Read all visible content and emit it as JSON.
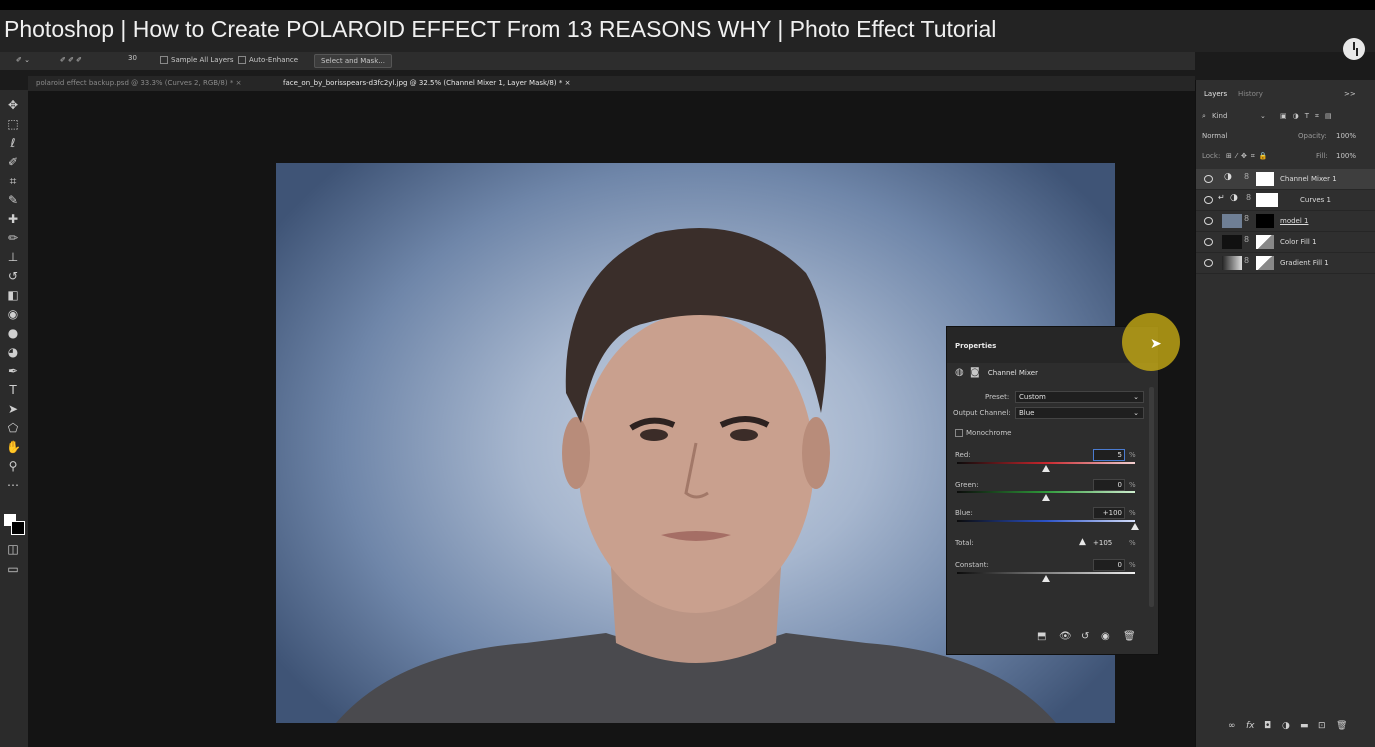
{
  "video_title": "Photoshop | How to Create POLAROID EFFECT From 13 REASONS WHY | Photo Effect Tutorial",
  "options": {
    "brush_size": "30",
    "sample_all_layers": "Sample All Layers",
    "auto_enhance": "Auto-Enhance",
    "select_and_mask": "Select and Mask..."
  },
  "tabs": [
    {
      "label": "polaroid effect backup.psd @ 33.3% (Curves 2, RGB/8) *",
      "close": "×"
    },
    {
      "label": "face_on_by_borisspears-d3fc2yl.jpg @ 32.5% (Channel Mixer 1, Layer Mask/8) *",
      "close": "×"
    }
  ],
  "layers_panel": {
    "tab_layers": "Layers",
    "tab_history": "History",
    "collapse": ">>",
    "kind": "Kind",
    "blend_mode": "Normal",
    "opacity_label": "Opacity:",
    "opacity_value": "100%",
    "lock_label": "Lock:",
    "fill_label": "Fill:",
    "fill_value": "100%",
    "layers": [
      {
        "name": "Channel Mixer 1"
      },
      {
        "name": "Curves 1"
      },
      {
        "name": "model 1"
      },
      {
        "name": "Color Fill 1"
      },
      {
        "name": "Gradient Fill 1"
      }
    ]
  },
  "properties": {
    "title": "Properties",
    "adjustment": "Channel Mixer",
    "preset_label": "Preset:",
    "preset_value": "Custom",
    "output_label": "Output Channel:",
    "output_value": "Blue",
    "monochrome": "Monochrome",
    "red_label": "Red:",
    "red_value": "5",
    "green_label": "Green:",
    "green_value": "0",
    "blue_label": "Blue:",
    "blue_value": "+100",
    "total_label": "Total:",
    "total_value": "+105",
    "constant_label": "Constant:",
    "constant_value": "0",
    "percent": "%",
    "slider_levels": {
      "red": 0.5,
      "green": 0.5,
      "blue": 1.0,
      "constant": 0.5
    }
  },
  "colors": {
    "accent": "#d2b414",
    "red": "#c8262d",
    "green": "#2f9a3a",
    "blue": "#2b52c8"
  }
}
